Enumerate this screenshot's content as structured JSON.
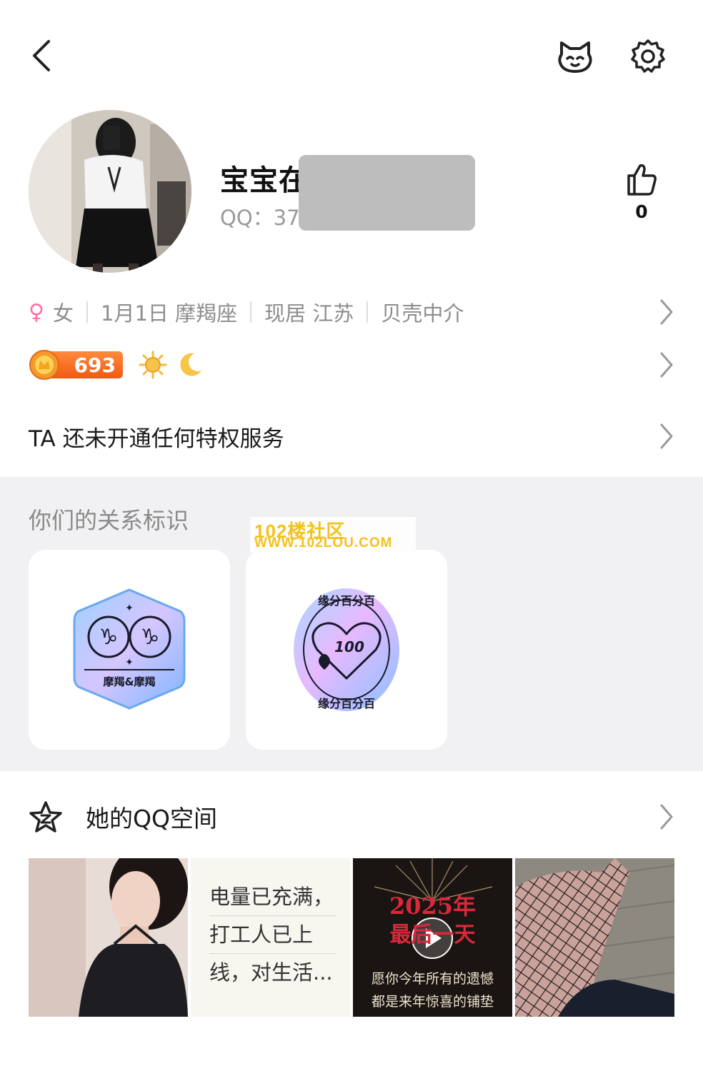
{
  "header": {
    "back_icon": "chevron-left-icon",
    "pet_icon": "pet-face-icon",
    "settings_icon": "gear-icon"
  },
  "profile": {
    "nickname": "宝宝在",
    "qq_label": "QQ：37",
    "like_count": "0"
  },
  "info": {
    "gender_symbol": "♀",
    "gender": "女",
    "birthday_sign": "1月1日 摩羯座",
    "location": "现居 江苏",
    "occupation": "贝壳中介"
  },
  "badges": {
    "level": "693"
  },
  "privilege": {
    "text": "TA 还未开通任何特权服务"
  },
  "relationship": {
    "title": "你们的关系标识",
    "cards": [
      {
        "label": "摩羯&摩羯"
      },
      {
        "label_top": "缘分百分百",
        "label_bottom": "缘分百分百",
        "score": "100"
      }
    ]
  },
  "watermark": {
    "line1": "102楼社区",
    "line2": "WWW.102LOU.COM"
  },
  "qzone": {
    "title": "她的QQ空间",
    "text_post": [
      "电量已充满，",
      "打工人已上",
      "线，对生活..."
    ],
    "photo3_title1": "2025年",
    "photo3_title2": "最后一天",
    "photo3_sub1": "愿你今年所有的遗憾",
    "photo3_sub2": "都是来年惊喜的铺垫"
  },
  "colors": {
    "accent_orange": "#f05a13",
    "gender_pink": "#ff6fa5",
    "section_bg": "#f1f1f3",
    "watermark_yellow": "#f3c21c"
  }
}
